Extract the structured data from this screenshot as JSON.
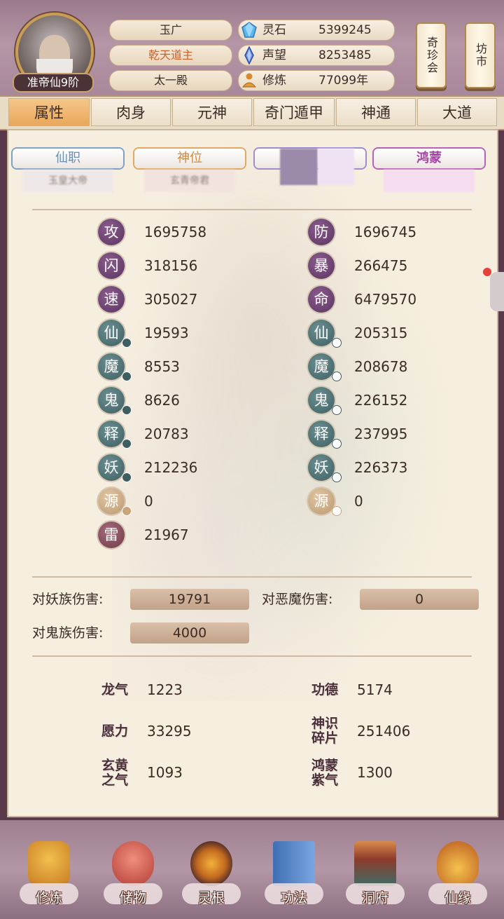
{
  "profile": {
    "rank": "准帝仙9阶",
    "name": "玉广",
    "title": "乾天道主",
    "hall": "太一殿"
  },
  "resources": [
    {
      "icon": "spirit-stone-icon",
      "label": "灵石",
      "value": "5399245"
    },
    {
      "icon": "reputation-crystal-icon",
      "label": "声望",
      "value": "8253485"
    },
    {
      "icon": "cultivation-figure-icon",
      "label": "修炼",
      "value": "77099年"
    }
  ],
  "side_buttons": [
    {
      "label": "奇珍会"
    },
    {
      "label": "坊市"
    }
  ],
  "tabs": [
    {
      "label": "属性",
      "active": true
    },
    {
      "label": "肉身"
    },
    {
      "label": "元神"
    },
    {
      "label": "奇门遁甲"
    },
    {
      "label": "神通"
    },
    {
      "label": "大道"
    }
  ],
  "title_cards": [
    {
      "head": "仙职",
      "sub": "玉皇大帝",
      "color": "#6a8fb3"
    },
    {
      "head": "神位",
      "sub": "玄青帝君",
      "color": "#d08a3c"
    },
    {
      "head": "",
      "sub": "",
      "color": "#8a74b8"
    },
    {
      "head": "鸿蒙",
      "sub": "",
      "color": "#a545a6"
    }
  ],
  "attributes_left": [
    {
      "glyph": "攻",
      "value": "1695758",
      "style": "purple"
    },
    {
      "glyph": "闪",
      "value": "318156",
      "style": "purple"
    },
    {
      "glyph": "速",
      "value": "305027",
      "style": "purple"
    },
    {
      "glyph": "仙",
      "value": "19593",
      "style": "teal"
    },
    {
      "glyph": "魔",
      "value": "8553",
      "style": "teal"
    },
    {
      "glyph": "鬼",
      "value": "8626",
      "style": "teal"
    },
    {
      "glyph": "释",
      "value": "20783",
      "style": "teal"
    },
    {
      "glyph": "妖",
      "value": "212236",
      "style": "teal"
    },
    {
      "glyph": "源",
      "value": "0",
      "style": "tan"
    },
    {
      "glyph": "雷",
      "value": "21967",
      "style": "red"
    }
  ],
  "attributes_right": [
    {
      "glyph": "防",
      "value": "1696745",
      "style": "purple"
    },
    {
      "glyph": "暴",
      "value": "266475",
      "style": "purple"
    },
    {
      "glyph": "命",
      "value": "6479570",
      "style": "purple"
    },
    {
      "glyph": "仙",
      "value": "205315",
      "style": "teal"
    },
    {
      "glyph": "魔",
      "value": "208678",
      "style": "teal"
    },
    {
      "glyph": "鬼",
      "value": "226152",
      "style": "teal"
    },
    {
      "glyph": "释",
      "value": "237995",
      "style": "teal"
    },
    {
      "glyph": "妖",
      "value": "226373",
      "style": "teal"
    },
    {
      "glyph": "源",
      "value": "0",
      "style": "tan"
    }
  ],
  "damage": {
    "vs_yao_label": "对妖族伤害:",
    "vs_yao_value": "19791",
    "vs_demon_label": "对恶魔伤害:",
    "vs_demon_value": "0",
    "vs_ghost_label": "对鬼族伤害:",
    "vs_ghost_value": "4000"
  },
  "misc": [
    {
      "label": "龙气",
      "value": "1223"
    },
    {
      "label": "功德",
      "value": "5174"
    },
    {
      "label": "愿力",
      "value": "33295"
    },
    {
      "label": "神识碎片",
      "value": "251406"
    },
    {
      "label": "玄黄之气",
      "value": "1093"
    },
    {
      "label": "鸿蒙紫气",
      "value": "1300"
    }
  ],
  "bottom_nav": [
    {
      "label": "修炼",
      "icon": "meditating-monk-icon"
    },
    {
      "label": "储物",
      "icon": "treasure-bag-icon"
    },
    {
      "label": "灵根",
      "icon": "spirit-root-emblem-icon"
    },
    {
      "label": "功法",
      "icon": "scripture-book-icon"
    },
    {
      "label": "洞府",
      "icon": "cave-palace-icon"
    },
    {
      "label": "仙缘",
      "icon": "gourd-yinyang-icon"
    }
  ],
  "colors": {
    "tab_active": "#e9a75a",
    "panel_bg": "#f6efe0",
    "header_bg": "#b596a6"
  }
}
